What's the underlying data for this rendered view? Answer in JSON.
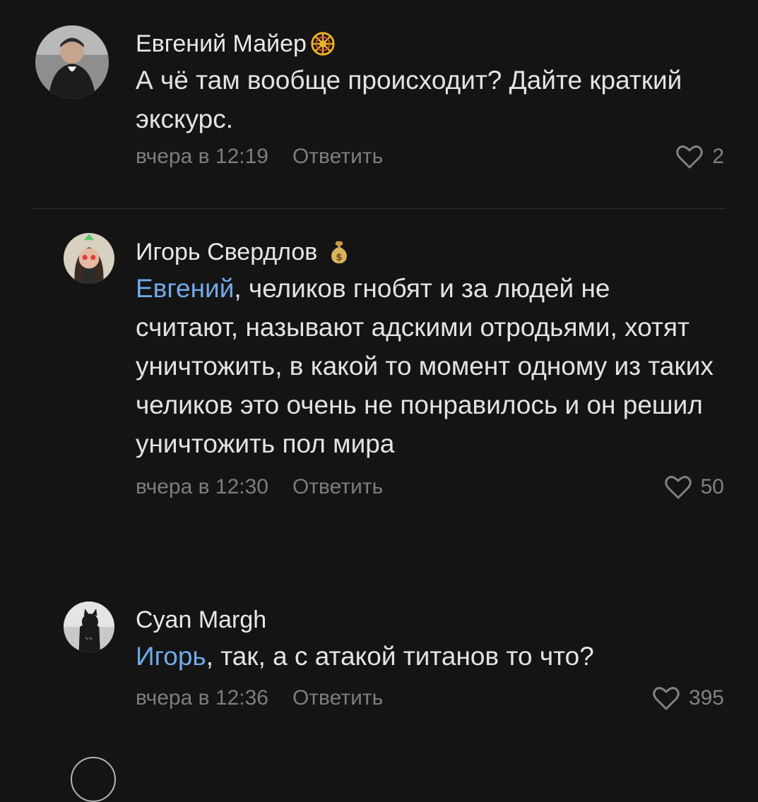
{
  "comments": [
    {
      "author": "Евгений Майер",
      "badge_icon": "sun-wheel-badge-icon",
      "text": "А чё там вообще происходит? Дайте краткий экскурс.",
      "time": "вчера в 12:19",
      "reply_label": "Ответить",
      "likes": "2"
    },
    {
      "author": "Игорь Свердлов",
      "badge_icon": "money-bag-badge-icon",
      "mention": "Евгений",
      "text": ", челиков гнобят и за людей не считают, называют адскими отродьями, хотят уничтожить, в какой то момент одному из таких челиков это очень не понравилось и он решил уничтожить пол мира",
      "time": "вчера в 12:30",
      "reply_label": "Ответить",
      "likes": "50"
    },
    {
      "author": "Cyan Margh",
      "mention": "Игорь",
      "text": ", так, а с атакой титанов то что?",
      "time": "вчера в 12:36",
      "reply_label": "Ответить",
      "likes": "395"
    }
  ],
  "colors": {
    "background": "#141414",
    "mention": "#71aaeb",
    "meta": "#7d7d7d"
  }
}
